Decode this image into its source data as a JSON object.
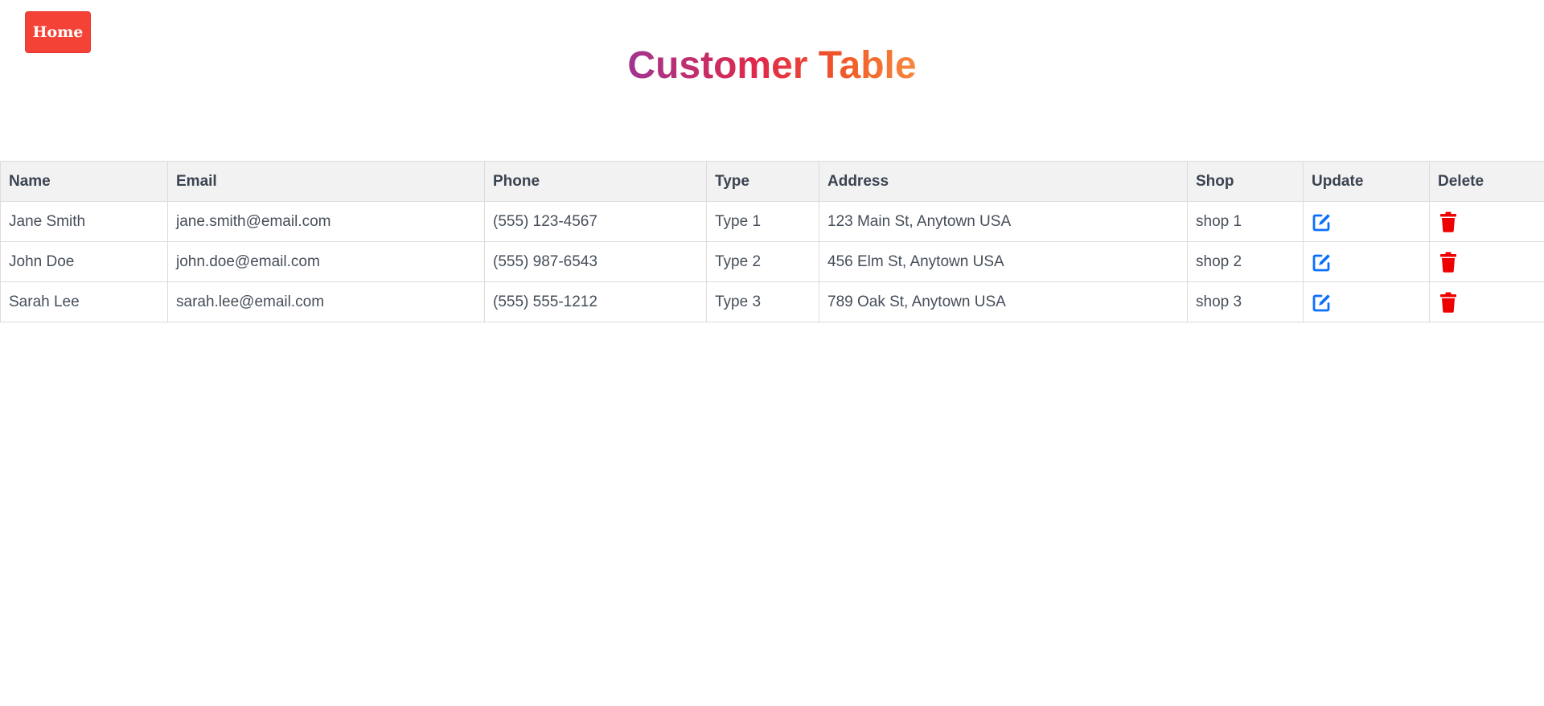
{
  "nav": {
    "home_label": "Home"
  },
  "page": {
    "title": "Customer Table"
  },
  "table": {
    "columns": [
      "Name",
      "Email",
      "Phone",
      "Type",
      "Address",
      "Shop",
      "Update",
      "Delete"
    ],
    "rows": [
      {
        "name": "Jane Smith",
        "email": "jane.smith@email.com",
        "phone": "(555) 123-4567",
        "type": "Type 1",
        "address": "123 Main St, Anytown USA",
        "shop": "shop 1"
      },
      {
        "name": "John Doe",
        "email": "john.doe@email.com",
        "phone": "(555) 987-6543",
        "type": "Type 2",
        "address": "456 Elm St, Anytown USA",
        "shop": "shop 2"
      },
      {
        "name": "Sarah Lee",
        "email": "sarah.lee@email.com",
        "phone": "(555) 555-1212",
        "type": "Type 3",
        "address": "789 Oak St, Anytown USA",
        "shop": "shop 3"
      }
    ]
  },
  "icons": {
    "update": "edit-icon",
    "delete": "trash-icon"
  },
  "colors": {
    "home_button": "#f44336",
    "edit_icon": "#0d6efd",
    "delete_icon": "#ee0000"
  }
}
